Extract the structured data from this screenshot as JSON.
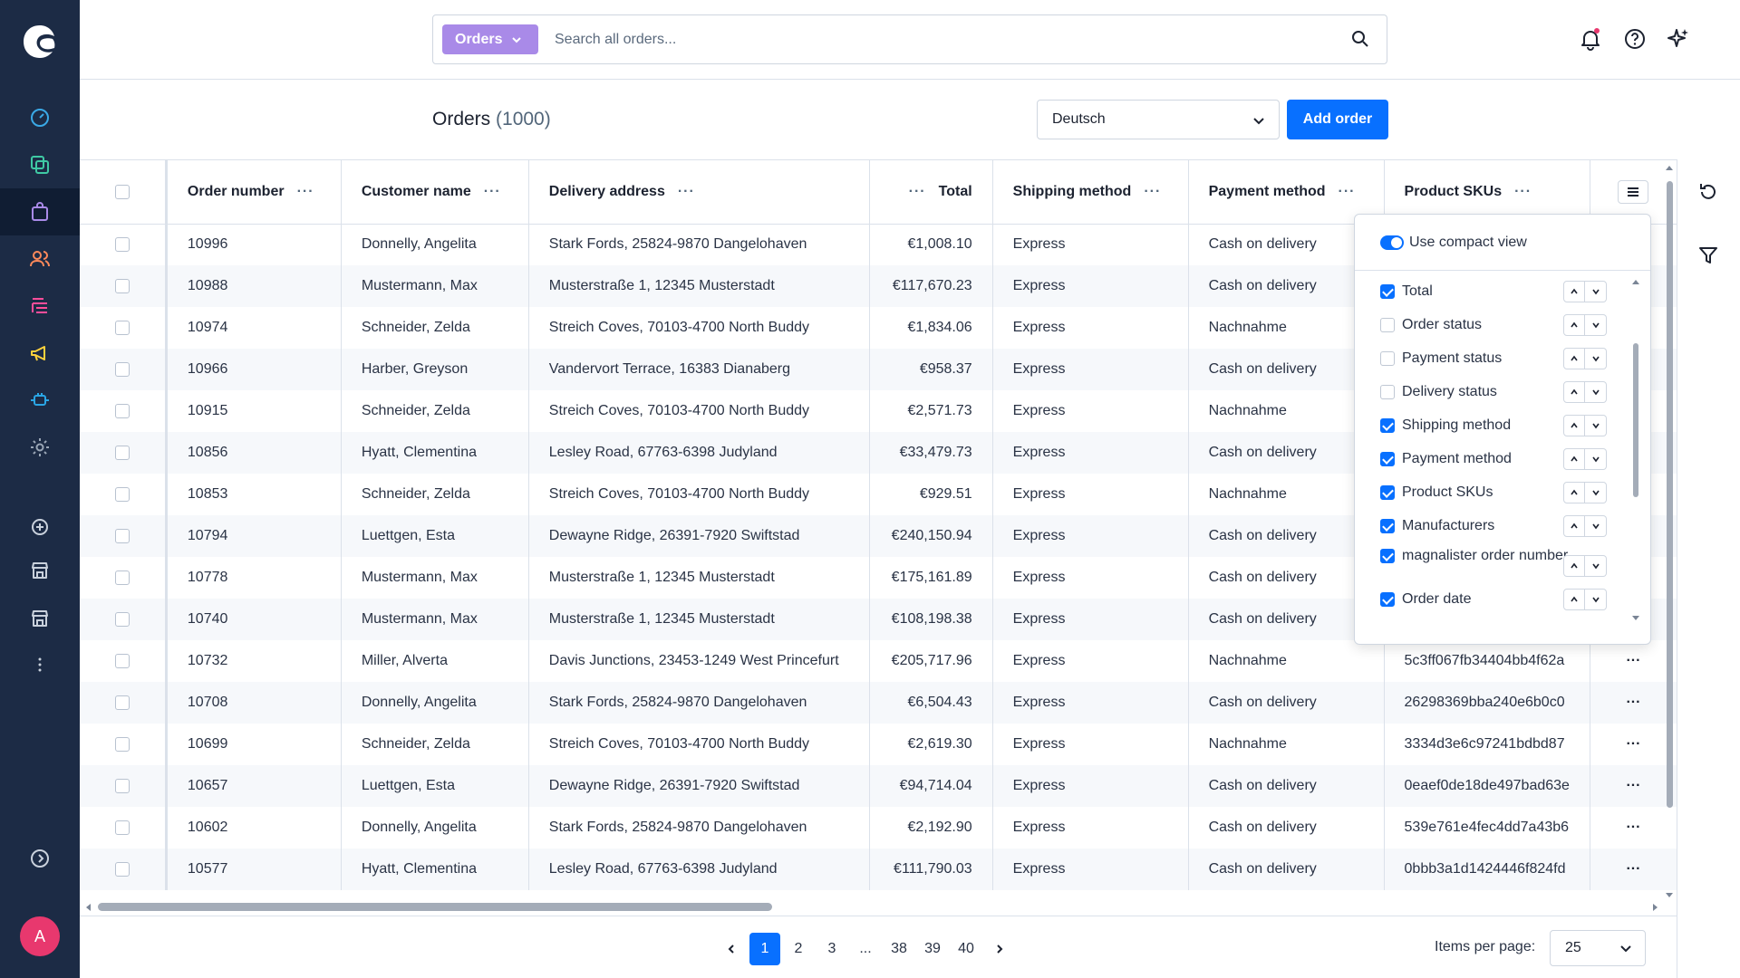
{
  "sidebar": {
    "items": [
      {
        "name": "dashboard-icon",
        "color": "#3aa9e6"
      },
      {
        "name": "catalogues-icon",
        "color": "#3fc9a4"
      },
      {
        "name": "orders-icon",
        "color": "#a98ae8"
      },
      {
        "name": "customers-icon",
        "color": "#ff8a5b"
      },
      {
        "name": "content-icon",
        "color": "#ff4e9a"
      },
      {
        "name": "marketing-icon",
        "color": "#ffd23c"
      },
      {
        "name": "extensions-icon",
        "color": "#2aa6e5"
      },
      {
        "name": "settings-icon",
        "color": "#9aa6b6"
      }
    ],
    "apps": [
      {
        "name": "add-sales-channel-icon"
      },
      {
        "name": "storefront-icon"
      },
      {
        "name": "storefront-2-icon"
      },
      {
        "name": "more-icon"
      }
    ],
    "avatar_initial": "A"
  },
  "search": {
    "module_label": "Orders",
    "placeholder": "Search all orders..."
  },
  "page": {
    "title": "Orders",
    "count": "(1000)",
    "language": "Deutsch",
    "add_button": "Add order"
  },
  "table": {
    "columns": [
      "Order number",
      "Customer name",
      "Delivery address",
      "Total",
      "Shipping method",
      "Payment method",
      "Product SKUs"
    ],
    "rows": [
      {
        "order": "10996",
        "customer": "Donnelly, Angelita",
        "address": "Stark Fords, 25824-9870 Dangelohaven",
        "total": "€1,008.10",
        "shipping": "Express",
        "payment": "Cash on delivery",
        "sku": ""
      },
      {
        "order": "10988",
        "customer": "Mustermann, Max",
        "address": "Musterstraße 1, 12345 Musterstadt",
        "total": "€117,670.23",
        "shipping": "Express",
        "payment": "Cash on delivery",
        "sku": ""
      },
      {
        "order": "10974",
        "customer": "Schneider, Zelda",
        "address": "Streich Coves, 70103-4700 North Buddy",
        "total": "€1,834.06",
        "shipping": "Express",
        "payment": "Nachnahme",
        "sku": ""
      },
      {
        "order": "10966",
        "customer": "Harber, Greyson",
        "address": "Vandervort Terrace, 16383 Dianaberg",
        "total": "€958.37",
        "shipping": "Express",
        "payment": "Cash on delivery",
        "sku": ""
      },
      {
        "order": "10915",
        "customer": "Schneider, Zelda",
        "address": "Streich Coves, 70103-4700 North Buddy",
        "total": "€2,571.73",
        "shipping": "Express",
        "payment": "Nachnahme",
        "sku": ""
      },
      {
        "order": "10856",
        "customer": "Hyatt, Clementina",
        "address": "Lesley Road, 67763-6398 Judyland",
        "total": "€33,479.73",
        "shipping": "Express",
        "payment": "Cash on delivery",
        "sku": ""
      },
      {
        "order": "10853",
        "customer": "Schneider, Zelda",
        "address": "Streich Coves, 70103-4700 North Buddy",
        "total": "€929.51",
        "shipping": "Express",
        "payment": "Nachnahme",
        "sku": ""
      },
      {
        "order": "10794",
        "customer": "Luettgen, Esta",
        "address": "Dewayne Ridge, 26391-7920 Swiftstad",
        "total": "€240,150.94",
        "shipping": "Express",
        "payment": "Cash on delivery",
        "sku": ""
      },
      {
        "order": "10778",
        "customer": "Mustermann, Max",
        "address": "Musterstraße 1, 12345 Musterstadt",
        "total": "€175,161.89",
        "shipping": "Express",
        "payment": "Cash on delivery",
        "sku": ""
      },
      {
        "order": "10740",
        "customer": "Mustermann, Max",
        "address": "Musterstraße 1, 12345 Musterstadt",
        "total": "€108,198.38",
        "shipping": "Express",
        "payment": "Cash on delivery",
        "sku": ""
      },
      {
        "order": "10732",
        "customer": "Miller, Alverta",
        "address": "Davis Junctions, 23453-1249 West Princefurt",
        "total": "€205,717.96",
        "shipping": "Express",
        "payment": "Nachnahme",
        "sku": "5c3ff067fb34404bb4f62a"
      },
      {
        "order": "10708",
        "customer": "Donnelly, Angelita",
        "address": "Stark Fords, 25824-9870 Dangelohaven",
        "total": "€6,504.43",
        "shipping": "Express",
        "payment": "Cash on delivery",
        "sku": "26298369bba240e6b0c0"
      },
      {
        "order": "10699",
        "customer": "Schneider, Zelda",
        "address": "Streich Coves, 70103-4700 North Buddy",
        "total": "€2,619.30",
        "shipping": "Express",
        "payment": "Nachnahme",
        "sku": "3334d3e6c97241bdbd87"
      },
      {
        "order": "10657",
        "customer": "Luettgen, Esta",
        "address": "Dewayne Ridge, 26391-7920 Swiftstad",
        "total": "€94,714.04",
        "shipping": "Express",
        "payment": "Cash on delivery",
        "sku": "0eaef0de18de497bad63e"
      },
      {
        "order": "10602",
        "customer": "Donnelly, Angelita",
        "address": "Stark Fords, 25824-9870 Dangelohaven",
        "total": "€2,192.90",
        "shipping": "Express",
        "payment": "Cash on delivery",
        "sku": "539e761e4fec4dd7a43b6"
      },
      {
        "order": "10577",
        "customer": "Hyatt, Clementina",
        "address": "Lesley Road, 67763-6398 Judyland",
        "total": "€111,790.03",
        "shipping": "Express",
        "payment": "Cash on delivery",
        "sku": "0bbb3a1d1424446f824fd"
      }
    ]
  },
  "column_settings": {
    "compact_label": "Use compact view",
    "compact_on": true,
    "items": [
      {
        "label": "Total",
        "checked": true
      },
      {
        "label": "Order status",
        "checked": false
      },
      {
        "label": "Payment status",
        "checked": false
      },
      {
        "label": "Delivery status",
        "checked": false
      },
      {
        "label": "Shipping method",
        "checked": true
      },
      {
        "label": "Payment method",
        "checked": true
      },
      {
        "label": "Product SKUs",
        "checked": true
      },
      {
        "label": "Manufacturers",
        "checked": true
      },
      {
        "label": "magnalister order number",
        "checked": true
      },
      {
        "label": "Order date",
        "checked": true
      }
    ]
  },
  "pagination": {
    "pages": [
      "1",
      "2",
      "3",
      "...",
      "38",
      "39",
      "40"
    ],
    "current": "1",
    "items_per_page_label": "Items per page:",
    "items_per_page": "25"
  },
  "colors": {
    "sidebar_bg": "#1c2b45",
    "primary": "#0870ff",
    "module_orders": "#a98ae8",
    "avatar": "#e8386e",
    "notification_dot": "#e8386e"
  }
}
